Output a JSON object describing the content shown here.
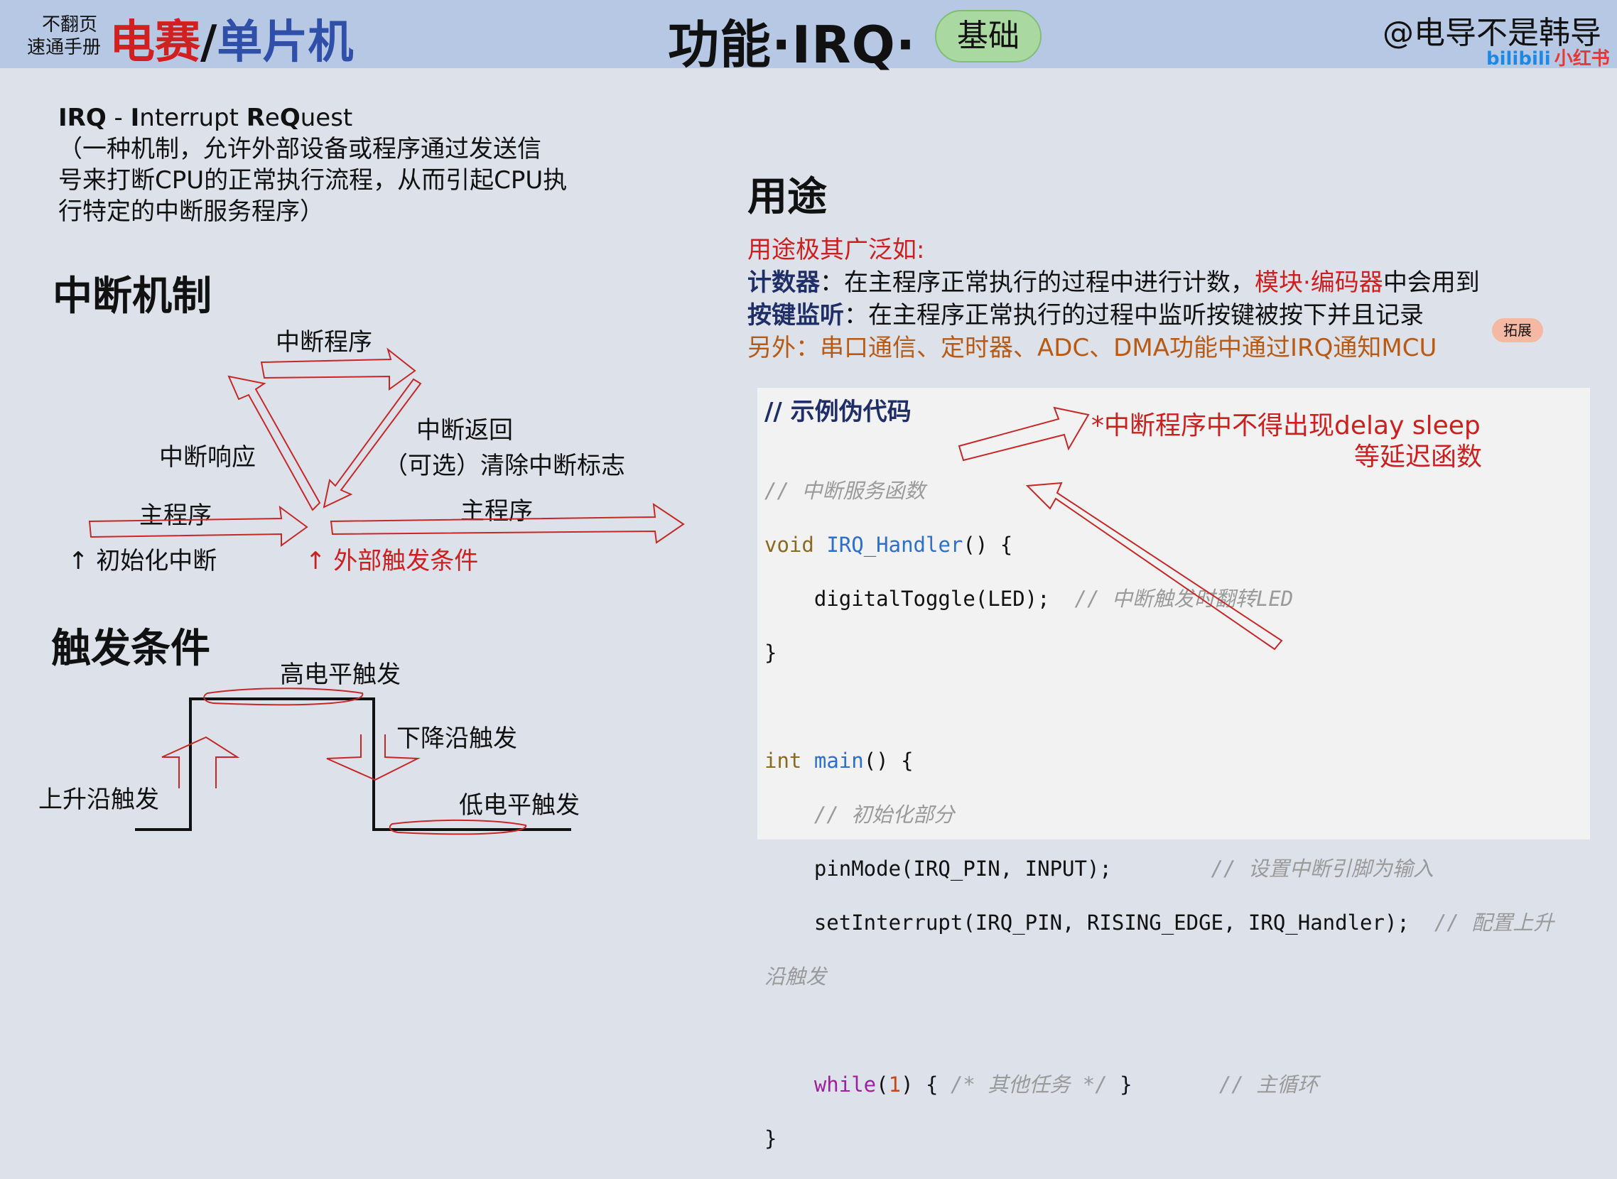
{
  "header": {
    "tag_line1": "不翻页",
    "tag_line2": "速通手册",
    "brand_red": "电赛",
    "brand_slash": "/",
    "brand_blue": "单片机",
    "title": "功能·IRQ·",
    "pill": "基础",
    "author": "@电导不是韩导",
    "bilibili": "bilibili",
    "xiaohongshu": "小红书"
  },
  "definition": {
    "irq_bold": "IRQ",
    "dash": " - ",
    "i": "I",
    "nterrupt": "nterrupt ",
    "re": "R",
    "e": "e",
    "q": "Q",
    "uest": "uest",
    "line1": "（一种机制，允许外部设备或程序通过发送信",
    "line2": "号来打断CPU的正常执行流程，从而引起CPU执",
    "line3": "行特定的中断服务程序）"
  },
  "mechanism": {
    "heading": "中断机制",
    "isr": "中断程序",
    "interrupt_response": "中断响应",
    "interrupt_return": "中断返回",
    "clear_flag": "（可选）清除中断标志",
    "main_left": "主程序",
    "main_right": "主程序",
    "init": "↑ 初始化中断",
    "external": "↑ 外部触发条件"
  },
  "trigger": {
    "heading": "触发条件",
    "high": "高电平触发",
    "falling": "下降沿触发",
    "rising": "上升沿触发",
    "low": "低电平触发"
  },
  "usage": {
    "heading": "用途",
    "intro": "用途极其广泛如:",
    "counter_label": "计数器",
    "counter_text": "：在主程序正常执行的过程中进行计数，",
    "counter_red": "模块·编码器",
    "counter_tail": "中会用到",
    "key_label": "按键监听",
    "key_text": "：在主程序正常执行的过程中监听按键被按下并且记录",
    "extra": "另外：串口通信、定时器、ADC、DMA功能中通过IRQ通知MCU",
    "badge": "拓展"
  },
  "code": {
    "title": "// 示例伪代码",
    "warning_line1": "*中断程序中不得出现delay sleep",
    "warning_line2": "等延迟函数",
    "c1": "// 中断服务函数",
    "void": "void",
    "handler": "IRQ_Handler",
    "paren_open": "() {",
    "toggle": "    digitalToggle(LED);",
    "toggle_cm": "  // 中断触发时翻转LED",
    "close1": "}",
    "int": "int",
    "main": "main",
    "main_paren": "() {",
    "c_init": "    // 初始化部分",
    "pinmode": "    pinMode(IRQ_PIN, INPUT);",
    "pinmode_cm": "        // 设置中断引脚为输入",
    "setint": "    setInterrupt(IRQ_PIN, RISING_EDGE, IRQ_Handler);",
    "setint_cm": "  // 配置上升",
    "setint_cm2": "沿触发",
    "while_indent": "    ",
    "while": "while",
    "while_open": "(",
    "one": "1",
    "while_close": ") { ",
    "while_cm": "/* 其他任务 */",
    "while_end": " }",
    "loop_cm": "       // 主循环",
    "close2": "}"
  }
}
